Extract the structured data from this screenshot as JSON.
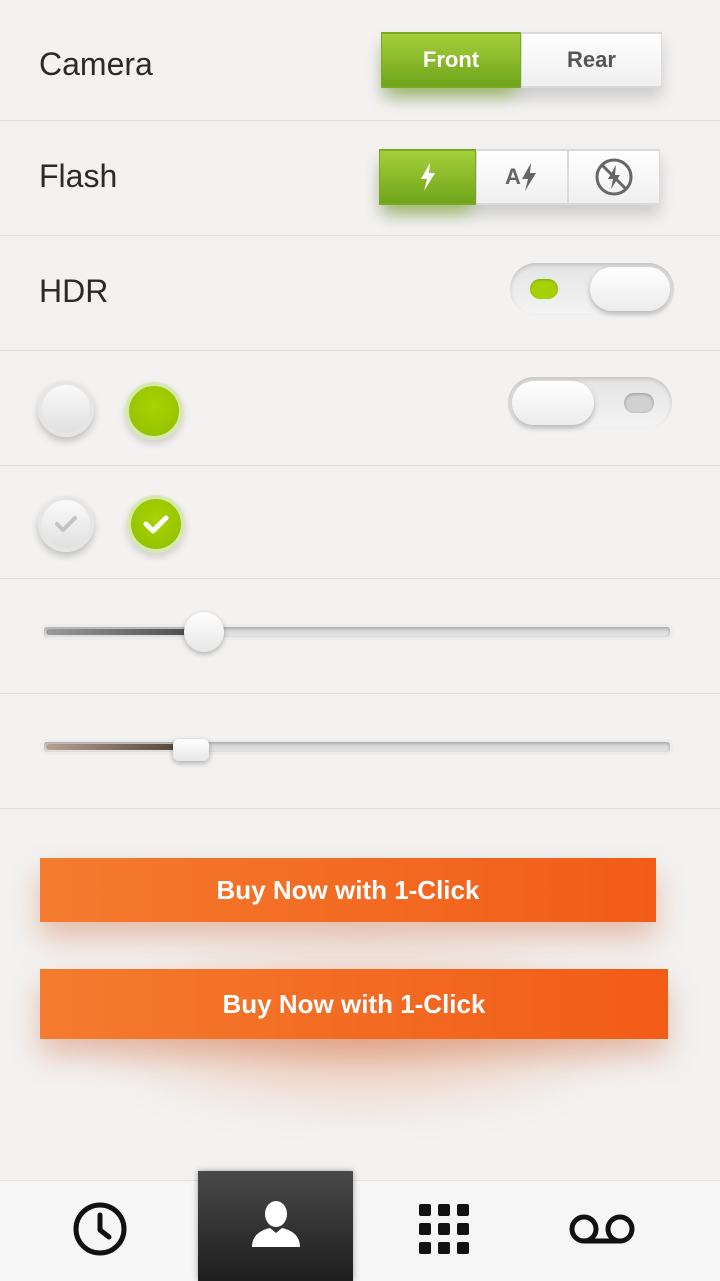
{
  "camera": {
    "label": "Camera",
    "options": [
      "Front",
      "Rear"
    ],
    "selected": "Front"
  },
  "flash": {
    "label": "Flash",
    "options": [
      "bolt-icon",
      "auto-flash-icon",
      "flash-off-icon"
    ],
    "auto_letter": "A",
    "selected": "bolt-icon"
  },
  "hdr": {
    "label": "HDR",
    "on": true
  },
  "toggle2": {
    "on": false
  },
  "radios": [
    {
      "checked": false
    },
    {
      "checked": true
    }
  ],
  "checkboxes": [
    {
      "checked": false
    },
    {
      "checked": true
    }
  ],
  "slider1": {
    "value": 0.26
  },
  "slider2": {
    "value": 0.24
  },
  "buy_buttons": [
    {
      "label": "Buy Now with 1-Click"
    },
    {
      "label": "Buy Now with 1-Click"
    }
  ],
  "tabbar": {
    "tabs": [
      "clock-icon",
      "contact-icon",
      "dialpad-icon",
      "voicemail-icon"
    ],
    "active": "contact-icon"
  },
  "colors": {
    "accent_green": "#8ebd00",
    "buy_orange": "#f25c17",
    "background": "#f3f2f1"
  }
}
